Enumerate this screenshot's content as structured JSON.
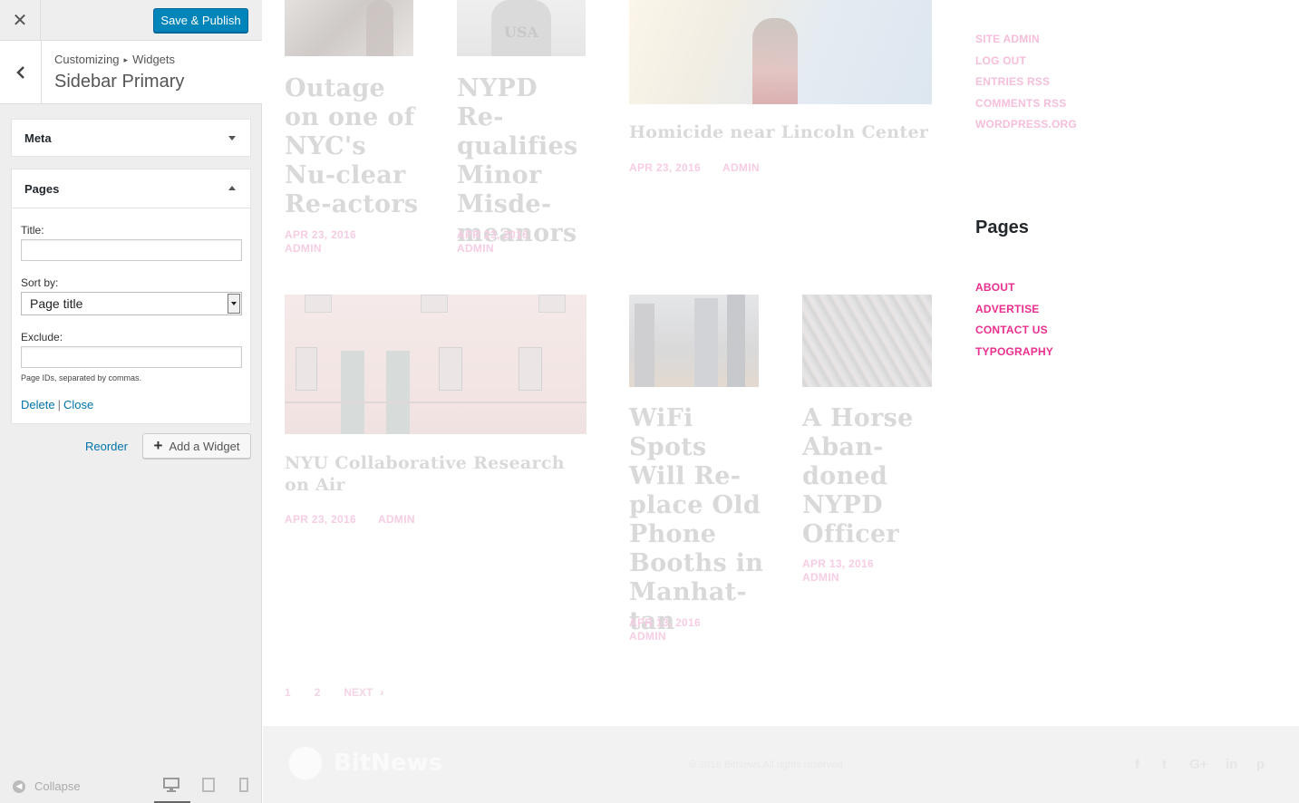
{
  "customizer": {
    "save_label": "Save & Publish",
    "breadcrumb_root": "Customizing",
    "breadcrumb_section": "Widgets",
    "section_title": "Sidebar Primary",
    "widgets": {
      "meta_title": "Meta",
      "pages_title": "Pages",
      "title_label": "Title:",
      "title_value": "",
      "sort_label": "Sort by:",
      "sort_value": "Page title",
      "exclude_label": "Exclude:",
      "exclude_value": "",
      "exclude_desc": "Page IDs, separated by commas.",
      "delete_label": "Delete",
      "separator": "|",
      "close_label": "Close"
    },
    "reorder_label": "Reorder",
    "add_widget_label": "Add a Widget",
    "collapse_label": "Collapse"
  },
  "posts": [
    {
      "title": "Outage on one of NYC's Nu-clear Re-actors",
      "date": "APR 23, 2016",
      "author": "ADMIN"
    },
    {
      "title": "NYPD Re-qualifies Minor Misde-meanors",
      "date": "APR 23, 2016",
      "author": "ADMIN"
    },
    {
      "title": "Homicide near Lincoln Center",
      "date": "APR 23, 2016",
      "author": "ADMIN"
    },
    {
      "title": "NYU Collaborative Research on Air",
      "date": "APR 23, 2016",
      "author": "ADMIN"
    },
    {
      "title": "WiFi Spots Will Re-place Old Phone Booths in Manhat-tan",
      "date": "APR 13, 2016",
      "author": "ADMIN"
    },
    {
      "title": "A Horse Aban-doned NYPD Officer",
      "date": "APR 13, 2016",
      "author": "ADMIN"
    }
  ],
  "pagination": {
    "page1": "1",
    "page2": "2",
    "next": "NEXT"
  },
  "sidebar": {
    "meta_links": [
      "SITE ADMIN",
      "LOG OUT",
      "ENTRIES RSS",
      "COMMENTS RSS",
      "WORDPRESS.ORG"
    ],
    "pages_heading": "Pages",
    "pages_links": [
      "ABOUT",
      "ADVERTISE",
      "CONTACT US",
      "TYPOGRAPHY"
    ]
  },
  "footer": {
    "logo_text": "BitNews",
    "copyright": "© 2016 BitNews All rights reserved",
    "social_icons": [
      "facebook-icon",
      "twitter-icon",
      "google-plus-icon",
      "linkedin-icon",
      "pinterest-icon"
    ]
  },
  "colors": {
    "accent": "#0085ba",
    "link": "#0073aa",
    "pink": "#e92f8f"
  }
}
